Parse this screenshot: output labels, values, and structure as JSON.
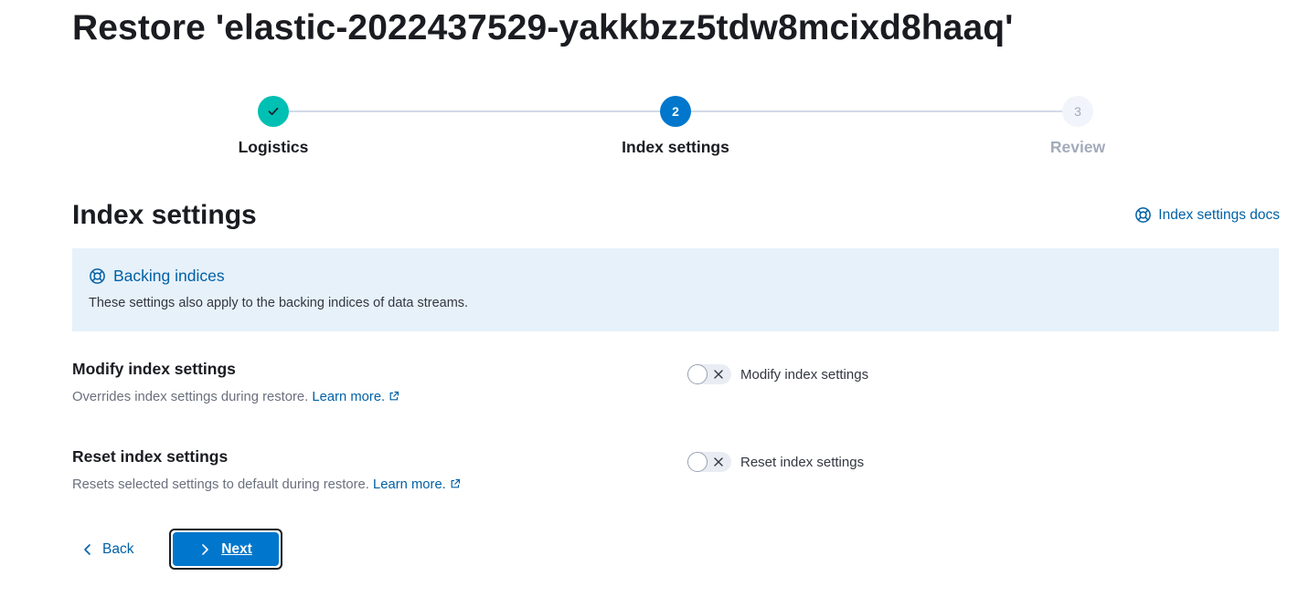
{
  "page": {
    "title": "Restore 'elastic-2022437529-yakkbzz5tdw8mcixd8haaq'"
  },
  "stepper": {
    "steps": [
      {
        "number": "",
        "title": "Logistics",
        "status": "complete",
        "icon": "check-icon"
      },
      {
        "number": "2",
        "title": "Index settings",
        "status": "current"
      },
      {
        "number": "3",
        "title": "Review",
        "status": "disabled"
      }
    ]
  },
  "section": {
    "title": "Index settings",
    "docs_link": "Index settings docs",
    "docs_icon": "lifebuoy-icon"
  },
  "callout": {
    "title": "Backing indices",
    "body": "These settings also apply to the backing indices of data streams.",
    "icon": "lifebuoy-icon"
  },
  "settings": [
    {
      "title": "Modify index settings",
      "description": "Overrides index settings during restore.",
      "link": "Learn more.",
      "switch_label": "Modify index settings",
      "enabled": false
    },
    {
      "title": "Reset index settings",
      "description": "Resets selected settings to default during restore.",
      "link": "Learn more.",
      "switch_label": "Reset index settings",
      "enabled": false
    }
  ],
  "footer": {
    "back_label": "Back",
    "next_label": "Next"
  },
  "colors": {
    "primary": "#0077cc",
    "link": "#0061a6",
    "success": "#00bfb3",
    "callout_bg": "#e6f1fa"
  }
}
